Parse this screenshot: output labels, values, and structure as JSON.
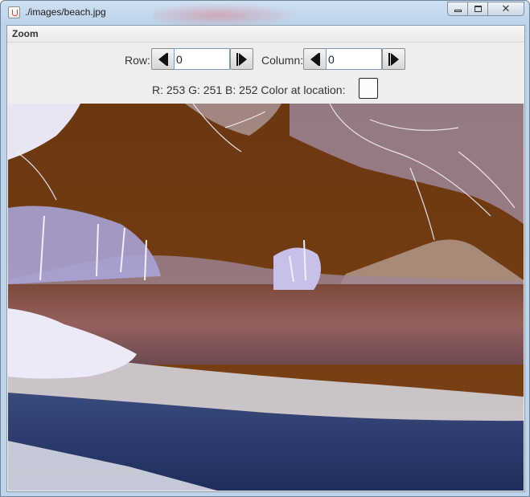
{
  "window": {
    "title": "./images/beach.jpg",
    "icon": "java-cup-icon",
    "buttons": [
      "minimize",
      "maximize",
      "close"
    ],
    "close_glyph": "✕"
  },
  "menu": {
    "items": [
      "Zoom"
    ]
  },
  "navigation": {
    "row_label": "Row:",
    "row_value": "0",
    "column_label": "Column:",
    "column_value": "0"
  },
  "pixel_info": {
    "text": "R: 253  G: 251  B: 252  Color at location:",
    "swatch_color": "#fdfbfc"
  },
  "image": {
    "description_colors": {
      "sky": "#6b3a14",
      "sea": "#8c5a58",
      "foreground": "#2c3d6e"
    }
  }
}
